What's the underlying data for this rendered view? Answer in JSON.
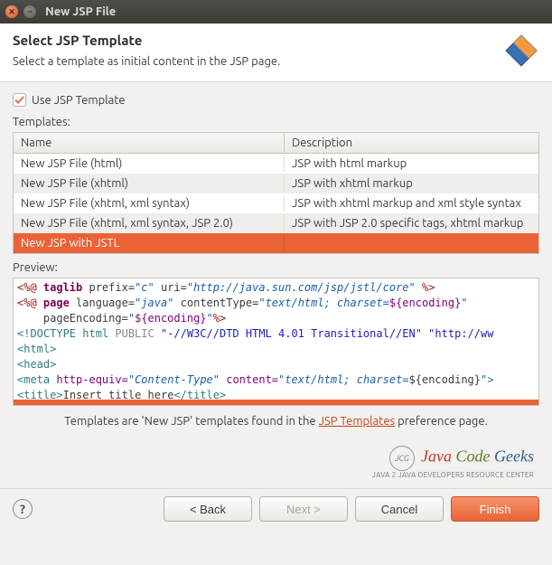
{
  "window": {
    "title": "New JSP File"
  },
  "header": {
    "title": "Select JSP Template",
    "subtitle": "Select a template as initial content in the JSP page."
  },
  "checkbox": {
    "label": "Use JSP Template",
    "checked": true
  },
  "templates": {
    "label": "Templates:",
    "columns": {
      "name": "Name",
      "description": "Description"
    },
    "rows": [
      {
        "name": "New JSP File (html)",
        "desc": "JSP with html markup"
      },
      {
        "name": "New JSP File (xhtml)",
        "desc": "JSP with xhtml markup"
      },
      {
        "name": "New JSP File (xhtml, xml syntax)",
        "desc": "JSP with xhtml markup and xml style syntax"
      },
      {
        "name": "New JSP File (xhtml, xml syntax, JSP 2.0)",
        "desc": "JSP with JSP 2.0 specific tags, xhtml markup"
      },
      {
        "name": "New JSP with JSTL",
        "desc": ""
      }
    ],
    "selected": 4
  },
  "preview": {
    "label": "Preview:",
    "lines": [
      [
        {
          "t": "<%@",
          "c": "c-tag"
        },
        {
          "t": " taglib ",
          "c": "c-kw"
        },
        {
          "t": "prefix=",
          "c": ""
        },
        {
          "t": "\"c\"",
          "c": "c-str"
        },
        {
          "t": " uri=",
          "c": ""
        },
        {
          "t": "\"http://java.sun.com/jsp/jstl/core\"",
          "c": "c-str"
        },
        {
          "t": " %>",
          "c": "c-tag"
        }
      ],
      [
        {
          "t": "<%@",
          "c": "c-tag"
        },
        {
          "t": " page ",
          "c": "c-kw"
        },
        {
          "t": "language=",
          "c": ""
        },
        {
          "t": "\"java\"",
          "c": "c-str"
        },
        {
          "t": " contentType=",
          "c": ""
        },
        {
          "t": "\"text/html; charset=",
          "c": "c-str"
        },
        {
          "t": "${encoding}",
          "c": "c-attr"
        },
        {
          "t": "\"",
          "c": "c-str"
        }
      ],
      [
        {
          "t": "    pageEncoding=",
          "c": ""
        },
        {
          "t": "\"",
          "c": "c-str"
        },
        {
          "t": "${encoding}",
          "c": "c-attr"
        },
        {
          "t": "\"",
          "c": "c-str"
        },
        {
          "t": "%>",
          "c": "c-tag"
        }
      ],
      [
        {
          "t": "<!",
          "c": "c-teal"
        },
        {
          "t": "DOCTYPE ",
          "c": "c-teal"
        },
        {
          "t": "html ",
          "c": "c-teal"
        },
        {
          "t": "PUBLIC ",
          "c": "c-gray"
        },
        {
          "t": "\"-//W3C//DTD HTML 4.01 Transitional//EN\"",
          "c": "c-blue"
        },
        {
          "t": " ",
          "c": ""
        },
        {
          "t": "\"http://ww",
          "c": "c-blue"
        }
      ],
      [
        {
          "t": "<",
          "c": "c-teal"
        },
        {
          "t": "html",
          "c": "c-teal"
        },
        {
          "t": ">",
          "c": "c-teal"
        }
      ],
      [
        {
          "t": "<",
          "c": "c-teal"
        },
        {
          "t": "head",
          "c": "c-teal"
        },
        {
          "t": ">",
          "c": "c-teal"
        }
      ],
      [
        {
          "t": "<",
          "c": "c-teal"
        },
        {
          "t": "meta ",
          "c": "c-teal"
        },
        {
          "t": "http-equiv=",
          "c": "c-attr"
        },
        {
          "t": "\"Content-Type\"",
          "c": "c-str"
        },
        {
          "t": " content=",
          "c": "c-attr"
        },
        {
          "t": "\"text/html; charset=",
          "c": "c-str"
        },
        {
          "t": "${encoding}",
          "c": ""
        },
        {
          "t": "\"",
          "c": "c-str"
        },
        {
          "t": ">",
          "c": "c-teal"
        }
      ],
      [
        {
          "t": "<",
          "c": "c-teal"
        },
        {
          "t": "title",
          "c": "c-teal"
        },
        {
          "t": ">",
          "c": "c-teal"
        },
        {
          "t": "Insert title here",
          "c": ""
        },
        {
          "t": "</",
          "c": "c-teal"
        },
        {
          "t": "title",
          "c": "c-teal"
        },
        {
          "t": ">",
          "c": "c-teal"
        }
      ]
    ]
  },
  "footer_note": {
    "pre": "Templates are 'New JSP' templates found in the ",
    "link": "JSP Templates",
    "post": " preference page."
  },
  "logo": {
    "brand_java": "Java ",
    "brand_code": "Code ",
    "brand_geeks": "Geeks",
    "tagline": "JAVA 2 JAVA DEVELOPERS RESOURCE CENTER",
    "badge": "JCG"
  },
  "buttons": {
    "back": "< Back",
    "next": "Next >",
    "cancel": "Cancel",
    "finish": "Finish"
  }
}
